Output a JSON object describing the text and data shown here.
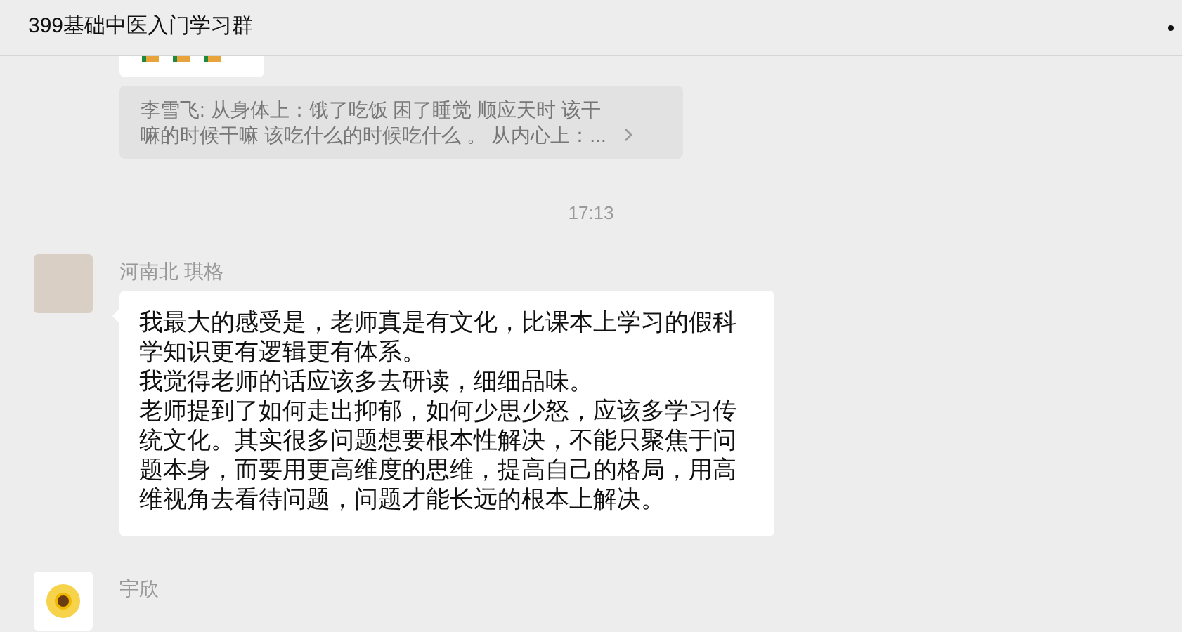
{
  "window": {
    "title": "399基础中医入门学习群"
  },
  "quote": {
    "text": "李雪飞: 从身体上：饿了吃饭 困了睡觉 顺应天时 该干嘛的时候干嘛 该吃什么的时候吃什么 。 从内心上：..."
  },
  "time": "17:13",
  "messages": [
    {
      "sender": "河南北 琪格",
      "kind": "photo",
      "paragraphs": [
        "我最大的感受是，老师真是有文化，比课本上学习的假科学知识更有逻辑更有体系。",
        "我觉得老师的话应该多去研读，细细品味。",
        "老师提到了如何走出抑郁，如何少思少怒，应该多学习传统文化。其实很多问题想要根本性解决，不能只聚焦于问题本身，而要用更高维度的思维，提高自己的格局，用高维视角去看待问题，问题才能长远的根本上解决。"
      ]
    },
    {
      "sender": "宇欣",
      "kind": "flower"
    }
  ]
}
